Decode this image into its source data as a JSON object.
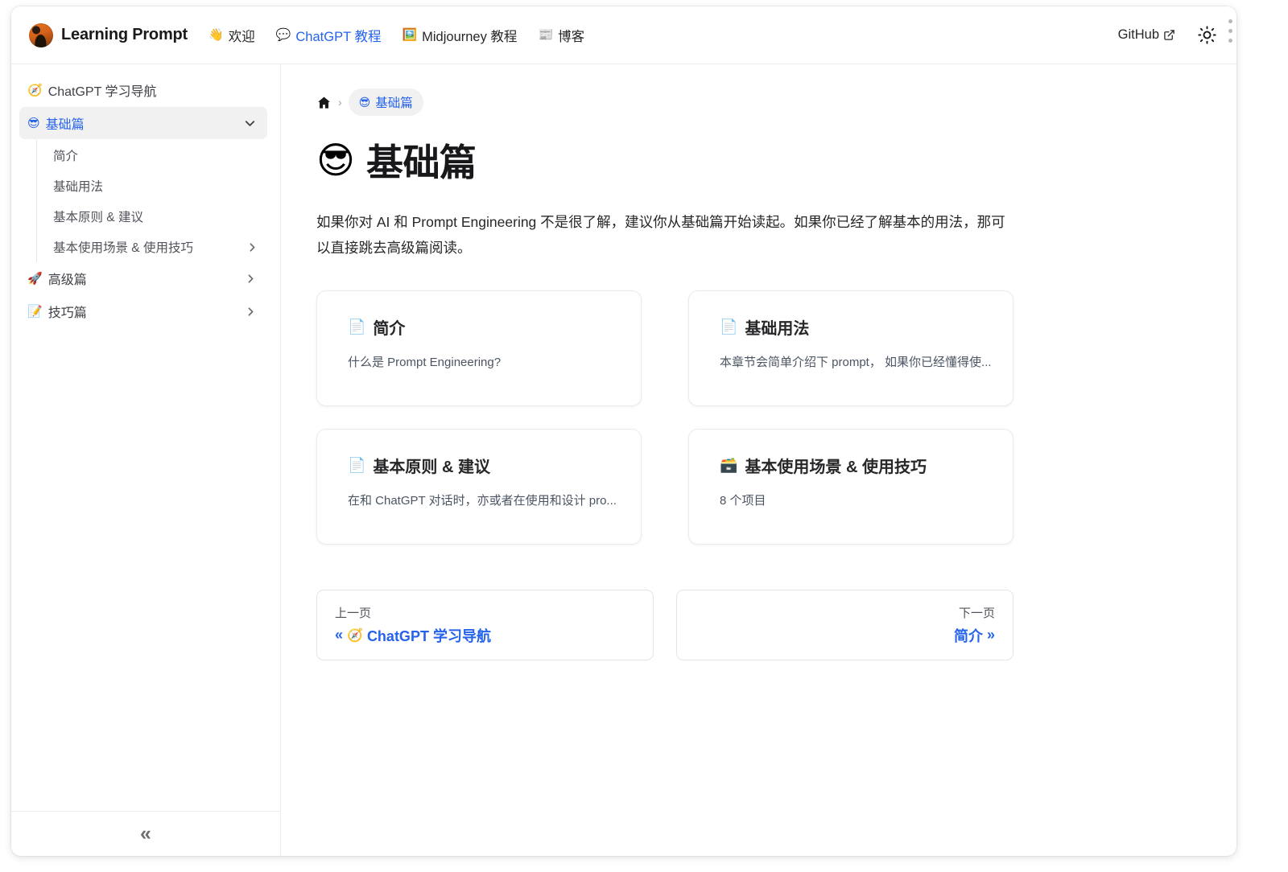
{
  "navbar": {
    "brand": "Learning Prompt",
    "logo_icon": "avatar-logo",
    "links": [
      {
        "emoji": "👋",
        "label": "欢迎",
        "icon": "wave-hand-icon",
        "active": false
      },
      {
        "emoji": "💬",
        "label": "ChatGPT 教程",
        "icon": "speech-bubble-icon",
        "active": true
      },
      {
        "emoji": "🖼️",
        "label": "Midjourney 教程",
        "icon": "picture-frame-icon",
        "active": false
      },
      {
        "emoji": "📰",
        "label": "博客",
        "icon": "newspaper-icon",
        "active": false
      }
    ],
    "github_label": "GitHub",
    "github_icon": "external-link-icon",
    "theme_icon": "sun-icon"
  },
  "sidebar": {
    "items": [
      {
        "emoji": "🧭",
        "label": "ChatGPT 学习导航",
        "active": false,
        "has_caret": false
      },
      {
        "emoji": "😎",
        "label": "基础篇",
        "active": true,
        "has_caret": true,
        "caret": "chevron-down-icon"
      }
    ],
    "children": [
      {
        "label": "简介",
        "has_caret": false
      },
      {
        "label": "基础用法",
        "has_caret": false
      },
      {
        "label": "基本原则 & 建议",
        "has_caret": false
      },
      {
        "label": "基本使用场景 & 使用技巧",
        "has_caret": true,
        "caret": "chevron-right-icon"
      }
    ],
    "items_after": [
      {
        "emoji": "🚀",
        "label": "高级篇",
        "active": false,
        "has_caret": true,
        "caret": "chevron-right-icon"
      },
      {
        "emoji": "📝",
        "label": "技巧篇",
        "active": false,
        "has_caret": true,
        "caret": "chevron-right-icon"
      }
    ],
    "collapse_glyph": "«",
    "collapse_icon": "chevron-double-left-icon"
  },
  "breadcrumb": {
    "home_icon": "home-icon",
    "separator": "›",
    "current_emoji": "😎",
    "current_label": "基础篇"
  },
  "page": {
    "title_emoji": "😎",
    "title": "基础篇",
    "intro": "如果你对 AI 和 Prompt Engineering 不是很了解，建议你从基础篇开始读起。如果你已经了解基本的用法，那可以直接跳去高级篇阅读。"
  },
  "cards": [
    {
      "emoji": "📄",
      "icon": "page-facing-up-icon",
      "title": "简介",
      "desc": "什么是 Prompt Engineering?"
    },
    {
      "emoji": "📄",
      "icon": "page-facing-up-icon",
      "title": "基础用法",
      "desc": "本章节会简单介绍下 prompt， 如果你已经懂得使..."
    },
    {
      "emoji": "📄",
      "icon": "page-facing-up-icon",
      "title": "基本原则 & 建议",
      "desc": "在和 ChatGPT 对话时，亦或者在使用和设计 pro..."
    },
    {
      "emoji": "🗃️",
      "icon": "card-file-box-icon",
      "title": "基本使用场景 & 使用技巧",
      "desc": "8 个项目"
    }
  ],
  "pager": {
    "prev_sub": "上一页",
    "prev_arrow": "«",
    "prev_emoji": "🧭",
    "prev_label": "ChatGPT 学习导航",
    "next_sub": "下一页",
    "next_label": "简介",
    "next_arrow": "»"
  },
  "colors": {
    "accent": "#2563eb",
    "text": "#27272a",
    "border": "#ededed",
    "active_bg": "#f1f1f1"
  }
}
